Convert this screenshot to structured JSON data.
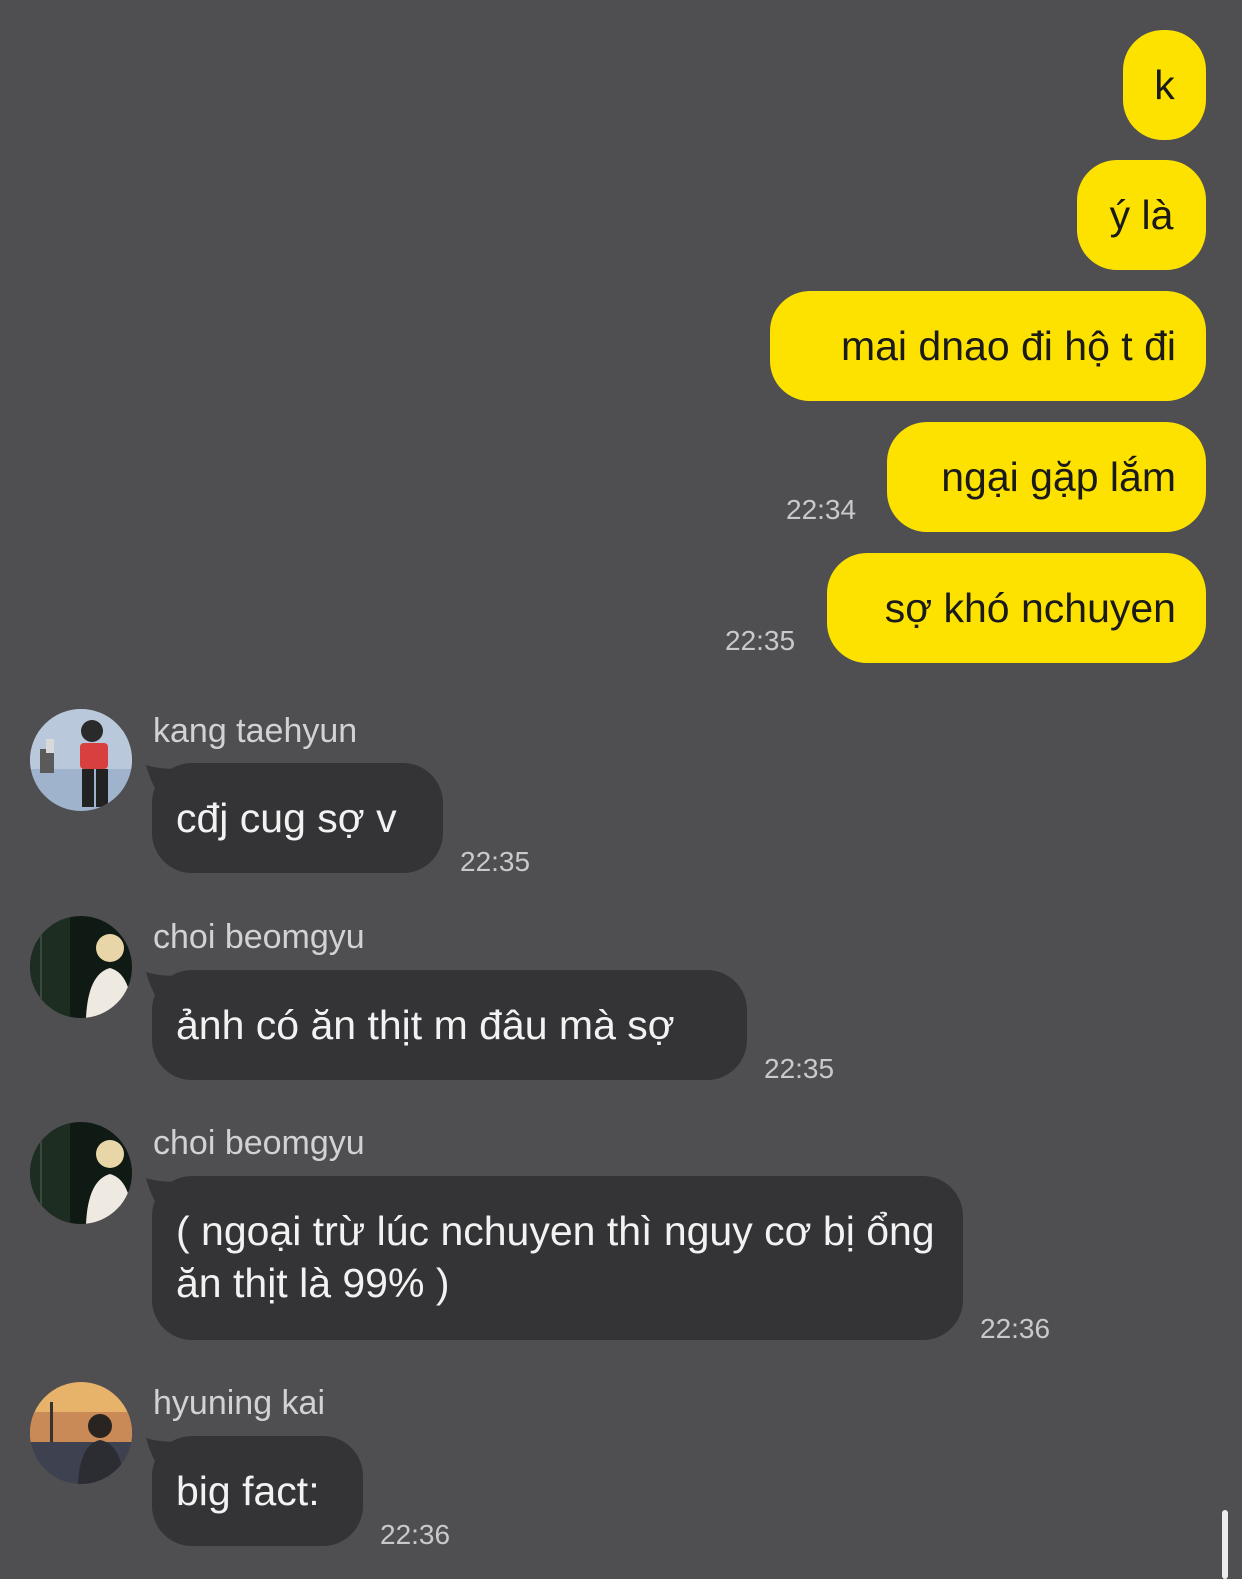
{
  "outgoing": [
    {
      "text": "k"
    },
    {
      "text": "ý là"
    },
    {
      "text": "mai dnao đi hộ t đi"
    },
    {
      "text": "ngại gặp lắm",
      "time": "22:34"
    },
    {
      "text": "sợ khó nchuyen",
      "time": "22:35"
    }
  ],
  "incoming": [
    {
      "sender": "kang taehyun",
      "avatar": "avatar-kang-taehyun",
      "text": "cđj cug sợ v",
      "time": "22:35"
    },
    {
      "sender": "choi beomgyu",
      "avatar": "avatar-choi-beomgyu",
      "text": "ảnh có ăn thịt m đâu mà sợ",
      "time": "22:35"
    },
    {
      "sender": "choi beomgyu",
      "avatar": "avatar-choi-beomgyu",
      "text": "( ngoại trừ lúc nchuyen thì nguy cơ bị ổng ăn thịt là 99% )",
      "time": "22:36"
    },
    {
      "sender": "hyuning kai",
      "avatar": "avatar-hyuning-kai",
      "text": "big fact:",
      "time": "22:36"
    }
  ],
  "colors": {
    "background": "#4f4e50",
    "outgoing_bubble": "#fde200",
    "incoming_bubble": "#343336",
    "timestamp": "#c9c8cb"
  }
}
